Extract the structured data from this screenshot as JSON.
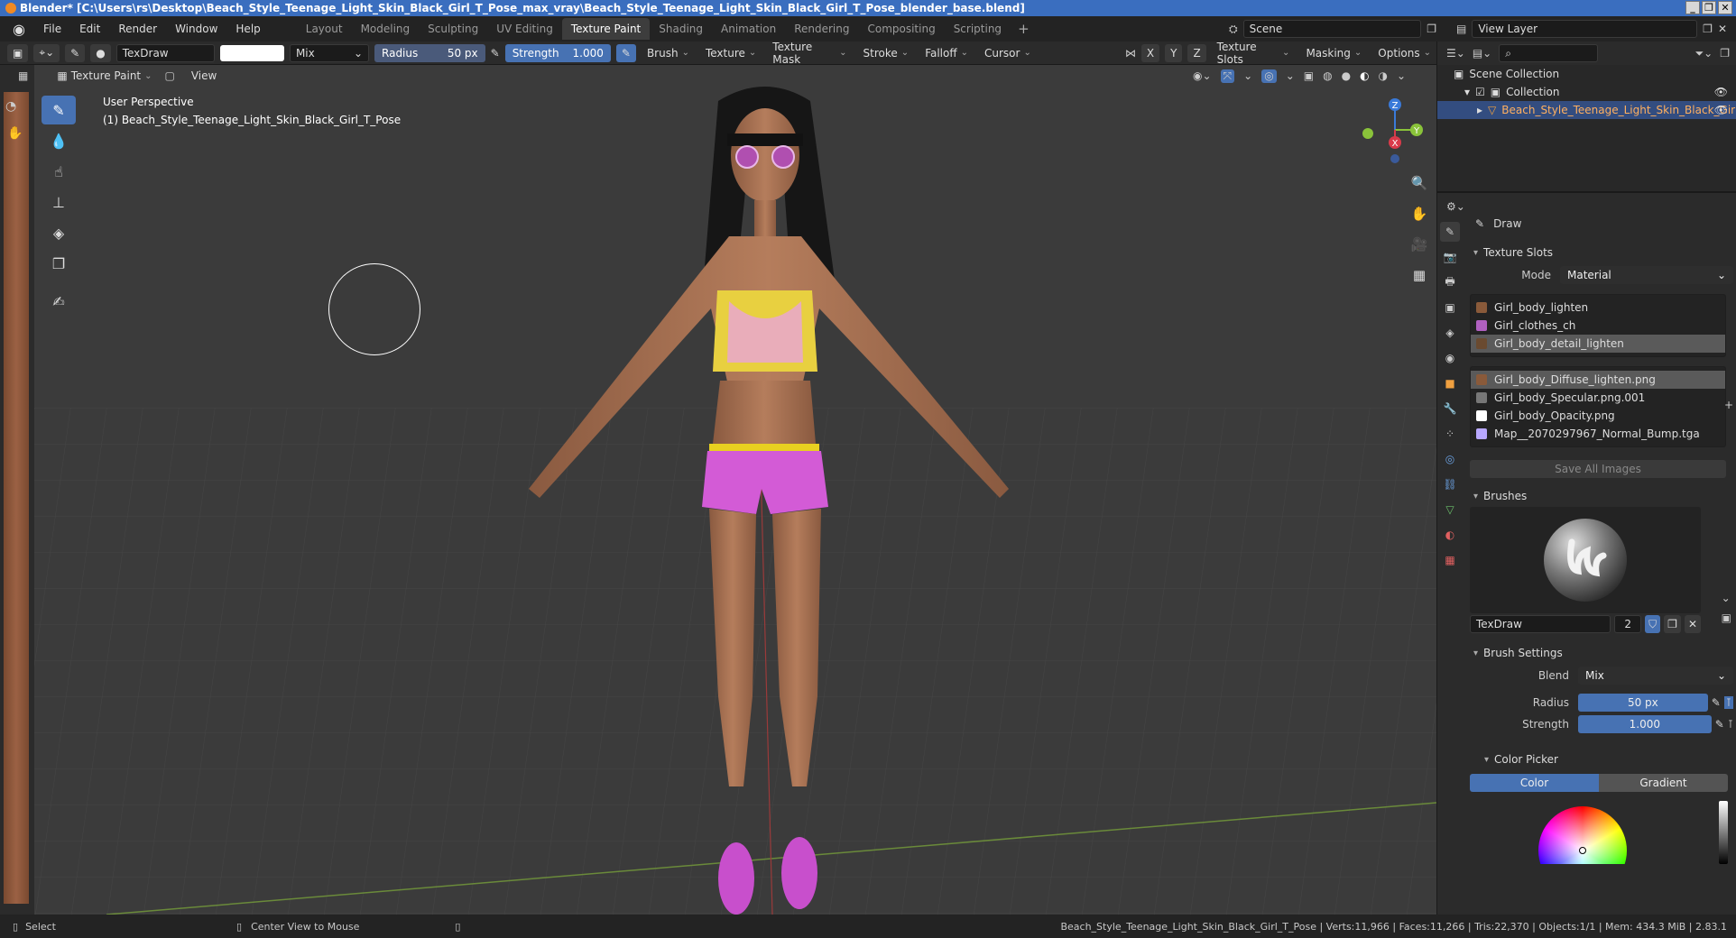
{
  "window": {
    "title": "Blender* [C:\\Users\\rs\\Desktop\\Beach_Style_Teenage_Light_Skin_Black_Girl_T_Pose_max_vray\\Beach_Style_Teenage_Light_Skin_Black_Girl_T_Pose_blender_base.blend]"
  },
  "menu": [
    "File",
    "Edit",
    "Render",
    "Window",
    "Help"
  ],
  "workspaces": [
    {
      "label": "Layout",
      "active": false
    },
    {
      "label": "Modeling",
      "active": false
    },
    {
      "label": "Sculpting",
      "active": false
    },
    {
      "label": "UV Editing",
      "active": false
    },
    {
      "label": "Texture Paint",
      "active": true
    },
    {
      "label": "Shading",
      "active": false
    },
    {
      "label": "Animation",
      "active": false
    },
    {
      "label": "Rendering",
      "active": false
    },
    {
      "label": "Compositing",
      "active": false
    },
    {
      "label": "Scripting",
      "active": false
    }
  ],
  "scene": {
    "name": "Scene",
    "view_layer": "View Layer"
  },
  "toolheader": {
    "brush_name": "TexDraw",
    "blend": "Mix",
    "radius_label": "Radius",
    "radius_value": "50 px",
    "strength_label": "Strength",
    "strength_value": "1.000",
    "menus": [
      "Brush",
      "Texture",
      "Texture Mask",
      "Stroke",
      "Falloff",
      "Cursor"
    ],
    "axes": [
      "X",
      "Y",
      "Z"
    ],
    "right_menus": [
      "Texture Slots",
      "Masking",
      "Options"
    ]
  },
  "subheader": {
    "mode": "Texture Paint",
    "view": "View"
  },
  "viewport": {
    "perspective": "User Perspective",
    "object_label": "(1) Beach_Style_Teenage_Light_Skin_Black_Girl_T_Pose",
    "gizmo_axes": [
      "Z",
      "Y",
      "X"
    ]
  },
  "outliner": {
    "scene_collection": "Scene Collection",
    "collection": "Collection",
    "object": "Beach_Style_Teenage_Light_Skin_Black_Girl"
  },
  "properties": {
    "tool_name": "Draw",
    "texture_slots": {
      "header": "Texture Slots",
      "mode_label": "Mode",
      "mode_value": "Material",
      "materials": [
        {
          "name": "Girl_body_lighten",
          "selected": false
        },
        {
          "name": "Girl_clothes_ch",
          "selected": false
        },
        {
          "name": "Girl_body_detail_lighten",
          "selected": true
        }
      ],
      "images": [
        {
          "name": "Girl_body_Diffuse_lighten.png",
          "selected": true,
          "color": "#8a5a3a"
        },
        {
          "name": "Girl_body_Specular.png.001",
          "selected": false,
          "color": "#777777"
        },
        {
          "name": "Girl_body_Opacity.png",
          "selected": false,
          "color": "#ffffff"
        },
        {
          "name": "Map__2070297967_Normal_Bump.tga",
          "selected": false,
          "color": "#b8a8ff"
        }
      ],
      "save_all": "Save All Images"
    },
    "brushes": {
      "header": "Brushes",
      "name": "TexDraw",
      "users": "2"
    },
    "brush_settings": {
      "header": "Brush Settings",
      "blend_label": "Blend",
      "blend_value": "Mix",
      "radius_label": "Radius",
      "radius_value": "50 px",
      "strength_label": "Strength",
      "strength_value": "1.000"
    },
    "color_picker": {
      "header": "Color Picker",
      "tabs": [
        "Color",
        "Gradient"
      ]
    }
  },
  "statusbar": {
    "select": "Select",
    "center": "Center View to Mouse",
    "info": "Beach_Style_Teenage_Light_Skin_Black_Girl_T_Pose | Verts:11,966 | Faces:11,266 | Tris:22,370 | Objects:1/1 | Mem: 434.3 MiB | 2.83.1"
  },
  "colors": {
    "accent": "#4772b3",
    "selection": "#334d80",
    "viewport": "#3b3b3b"
  }
}
